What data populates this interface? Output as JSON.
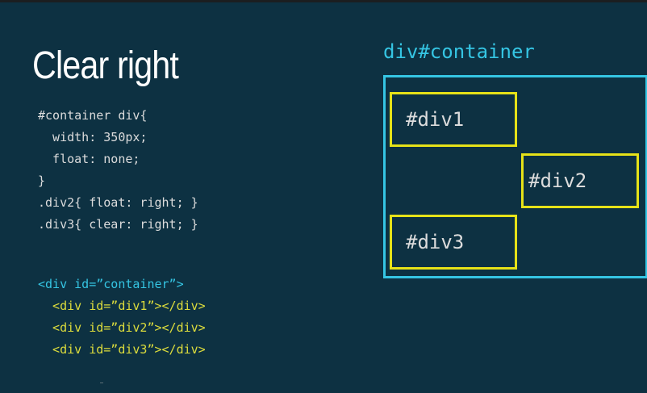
{
  "slide": {
    "title": "Clear right",
    "css_lines": [
      "#container div{",
      "  width: 350px;",
      "  float: none;",
      "}",
      ".div2{ float: right; }",
      ".div3{ clear: right; }"
    ],
    "html_lines": [
      "<div id=”container”>",
      "  <div id=”div1”></div>",
      "  <div id=”div2”></div>",
      "  <div id=”div3”></div>"
    ],
    "diagram": {
      "container_label": "div#container",
      "div1_label": "#div1",
      "div2_label": "#div2",
      "div3_label": "#div3"
    },
    "colors": {
      "background": "#0d3142",
      "title": "#ffffff",
      "code": "#dcdcdc",
      "container_accent": "#35c5e3",
      "div_accent": "#e6e218"
    }
  }
}
